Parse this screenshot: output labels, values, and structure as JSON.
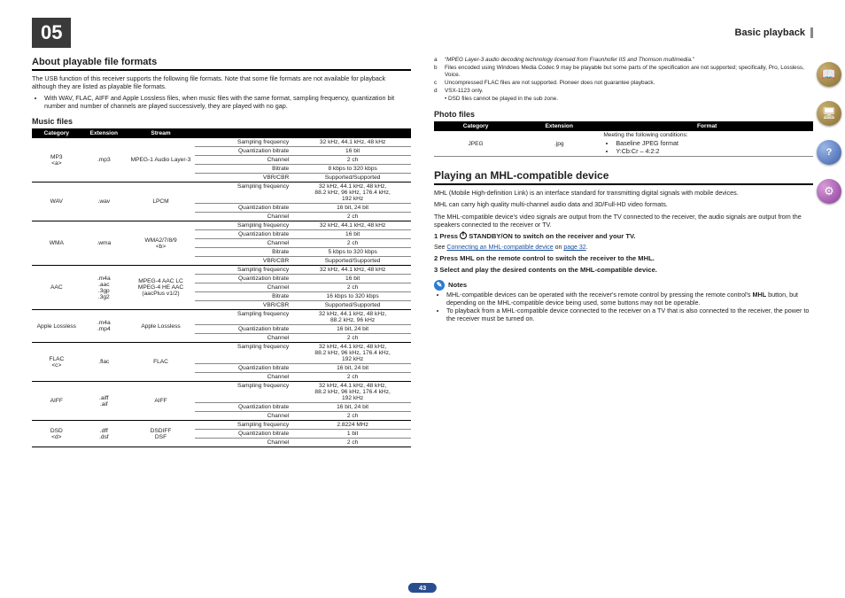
{
  "chapter_num": "05",
  "chapter_title": "Basic playback",
  "page_number": "43",
  "left": {
    "heading": "About playable file formats",
    "intro": "The USB function of this receiver supports the following file formats. Note that some file formats are not available for playback although they are listed as playable file formats.",
    "bullet": "With WAV, FLAC, AIFF and Apple Lossless files, when music files with the same format, sampling frequency, quantization bit number and number of channels are played successively, they are played with no gap.",
    "music_heading": "Music files",
    "thead": {
      "c1": "Category",
      "c2": "Extension",
      "c3": "Stream"
    },
    "rows": [
      {
        "cat": "MP3\n<a>",
        "ext": ".mp3",
        "stream": "MPEG-1 Audio Layer-3",
        "props": [
          [
            "Sampling frequency",
            "32 kHz, 44.1 kHz, 48 kHz"
          ],
          [
            "Quantization bitrate",
            "16 bit"
          ],
          [
            "Channel",
            "2 ch"
          ],
          [
            "Bitrate",
            "8 kbps to 320 kbps"
          ],
          [
            "VBR/CBR",
            "Supported/Supported"
          ]
        ]
      },
      {
        "cat": "WAV",
        "ext": ".wav",
        "stream": "LPCM",
        "props": [
          [
            "Sampling frequency",
            "32 kHz, 44.1 kHz, 48 kHz,\n88.2 kHz, 96 kHz, 176.4 kHz,\n192 kHz"
          ],
          [
            "Quantization bitrate",
            "16 bit, 24 bit"
          ],
          [
            "Channel",
            "2 ch"
          ]
        ]
      },
      {
        "cat": "WMA",
        "ext": ".wma",
        "stream": "WMA2/7/8/9\n<b>",
        "props": [
          [
            "Sampling frequency",
            "32 kHz, 44.1 kHz, 48 kHz"
          ],
          [
            "Quantization bitrate",
            "16 bit"
          ],
          [
            "Channel",
            "2 ch"
          ],
          [
            "Bitrate",
            "5 kbps to 320 kbps"
          ],
          [
            "VBR/CBR",
            "Supported/Supported"
          ]
        ]
      },
      {
        "cat": "AAC",
        "ext": ".m4a\n.aac\n.3gp\n.3g2",
        "stream": "MPEG-4 AAC LC\nMPEG-4 HE AAC\n(aacPlus v1/2)",
        "props": [
          [
            "Sampling frequency",
            "32 kHz, 44.1 kHz, 48 kHz"
          ],
          [
            "Quantization bitrate",
            "16 bit"
          ],
          [
            "Channel",
            "2 ch"
          ],
          [
            "Bitrate",
            "16 kbps to 320 kbps"
          ],
          [
            "VBR/CBR",
            "Supported/Supported"
          ]
        ]
      },
      {
        "cat": "Apple Lossless",
        "ext": ".m4a\n.mp4",
        "stream": "Apple Lossless",
        "props": [
          [
            "Sampling frequency",
            "32 kHz, 44.1 kHz, 48 kHz,\n88.2 kHz, 96 kHz"
          ],
          [
            "Quantization bitrate",
            "16 bit, 24 bit"
          ],
          [
            "Channel",
            "2 ch"
          ]
        ]
      },
      {
        "cat": "FLAC\n<c>",
        "ext": ".flac",
        "stream": "FLAC",
        "props": [
          [
            "Sampling frequency",
            "32 kHz, 44.1 kHz, 48 kHz,\n88.2 kHz, 96 kHz, 176.4 kHz,\n192 kHz"
          ],
          [
            "Quantization bitrate",
            "16 bit, 24 bit"
          ],
          [
            "Channel",
            "2 ch"
          ]
        ]
      },
      {
        "cat": "AIFF",
        "ext": ".aiff\n.aif",
        "stream": "AIFF",
        "props": [
          [
            "Sampling frequency",
            "32 kHz, 44.1 kHz, 48 kHz,\n88.2 kHz, 96 kHz, 176.4 kHz,\n192 kHz"
          ],
          [
            "Quantization bitrate",
            "16 bit, 24 bit"
          ],
          [
            "Channel",
            "2 ch"
          ]
        ]
      },
      {
        "cat": "DSD\n<d>",
        "ext": ".dff\n.dsf",
        "stream": "DSDIFF\nDSF",
        "props": [
          [
            "Sampling frequency",
            "2.8224 MHz"
          ],
          [
            "Quantization bitrate",
            "1 bit"
          ],
          [
            "Channel",
            "2 ch"
          ]
        ]
      }
    ]
  },
  "right": {
    "footnotes": [
      [
        "a",
        "“MPEG Layer-3 audio decoding technology licensed from Fraunhofer IIS and Thomson multimedia.”"
      ],
      [
        "b",
        "Files encoded using Windows Media Codec 9 may be playable but some parts of the specification are not supported; specifically, Pro, Lossless, Voice."
      ],
      [
        "c",
        "Uncompressed FLAC files are not supported. Pioneer does not guarantee playback."
      ],
      [
        "d",
        "VSX-1123 only."
      ],
      [
        "",
        "• DSD files cannot be played in the sub zone."
      ]
    ],
    "photo_heading": "Photo files",
    "photo_thead": {
      "c1": "Category",
      "c2": "Extension",
      "c3": "Format"
    },
    "photo_row": {
      "cat": "JPEG",
      "ext": ".jpg",
      "fmt_intro": "Meeting the following conditions:",
      "fmt_items": [
        "Baseline JPEG format",
        "Y:Cb:Cr – 4:2:2"
      ]
    },
    "mhl_heading": "Playing an MHL-compatible device",
    "mhl_p1": "MHL (Mobile High-definition Link) is an interface standard for transmitting digital signals with mobile devices.",
    "mhl_p2": "MHL can carry high quality multi-channel audio data and 3D/Full-HD video formats.",
    "mhl_p3": "The MHL-compatible device's video signals are output from the TV connected to the receiver, the audio signals are output from the speakers connected to the receiver or TV.",
    "step1_pre": "1    Press ",
    "step1_bold": "STANDBY/ON to switch on the receiver and your TV.",
    "see_pre": "See ",
    "see_link": "Connecting an MHL-compatible device",
    "see_mid": " on ",
    "see_page": "page 32",
    "see_post": ".",
    "step2": "2    Press MHL on the remote control to switch the receiver to the MHL.",
    "step3": "3    Select and play the desired contents on the MHL-compatible device.",
    "notes_label": "Notes",
    "note1_pre": "MHL-compatible devices can be operated with the receiver's remote control by pressing the remote control's ",
    "note1_bold": "MHL",
    "note1_post": " button, but depending on the MHL-compatible device being used, some buttons may not be operable.",
    "note2": "To playback from a MHL-compatible device connected to the receiver on a TV that is also connected to the receiver, the power to the receiver must be turned on."
  },
  "side_icons": [
    "book-icon",
    "devices-icon",
    "help-icon",
    "settings-icon"
  ]
}
